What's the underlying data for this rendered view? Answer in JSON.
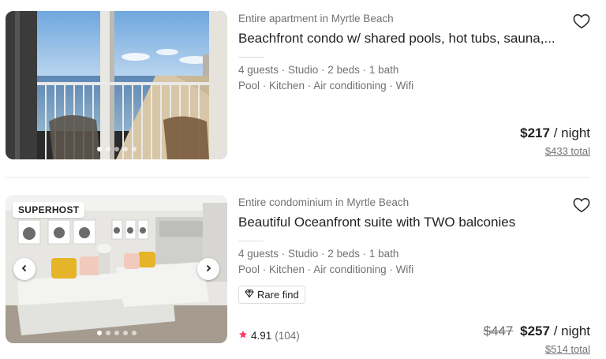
{
  "listings": [
    {
      "subtitle": "Entire apartment in Myrtle Beach",
      "title": "Beachfront condo w/ shared pools, hot tubs, sauna,...",
      "details_line1": "4 guests · Studio · 2 beds · 1 bath",
      "details_line2": "Pool · Kitchen · Air conditioning · Wifi",
      "price": "$217",
      "per_night": "/ night",
      "total": "$433 total",
      "saved": false
    },
    {
      "badge": "SUPERHOST",
      "subtitle": "Entire condominium in Myrtle Beach",
      "title": "Beautiful Oceanfront suite with TWO balconies",
      "details_line1": "4 guests · Studio · 2 beds · 1 bath",
      "details_line2": "Pool · Kitchen · Air conditioning · Wifi",
      "tag": "Rare find",
      "old_price": "$447",
      "price": "$257",
      "per_night": "/ night",
      "total": "$514 total",
      "rating": "4.91",
      "review_count": "(104)",
      "saved": false
    }
  ],
  "colors": {
    "text": "#222222",
    "muted": "#717171",
    "star": "#ff385c",
    "divider": "#ebebeb"
  }
}
